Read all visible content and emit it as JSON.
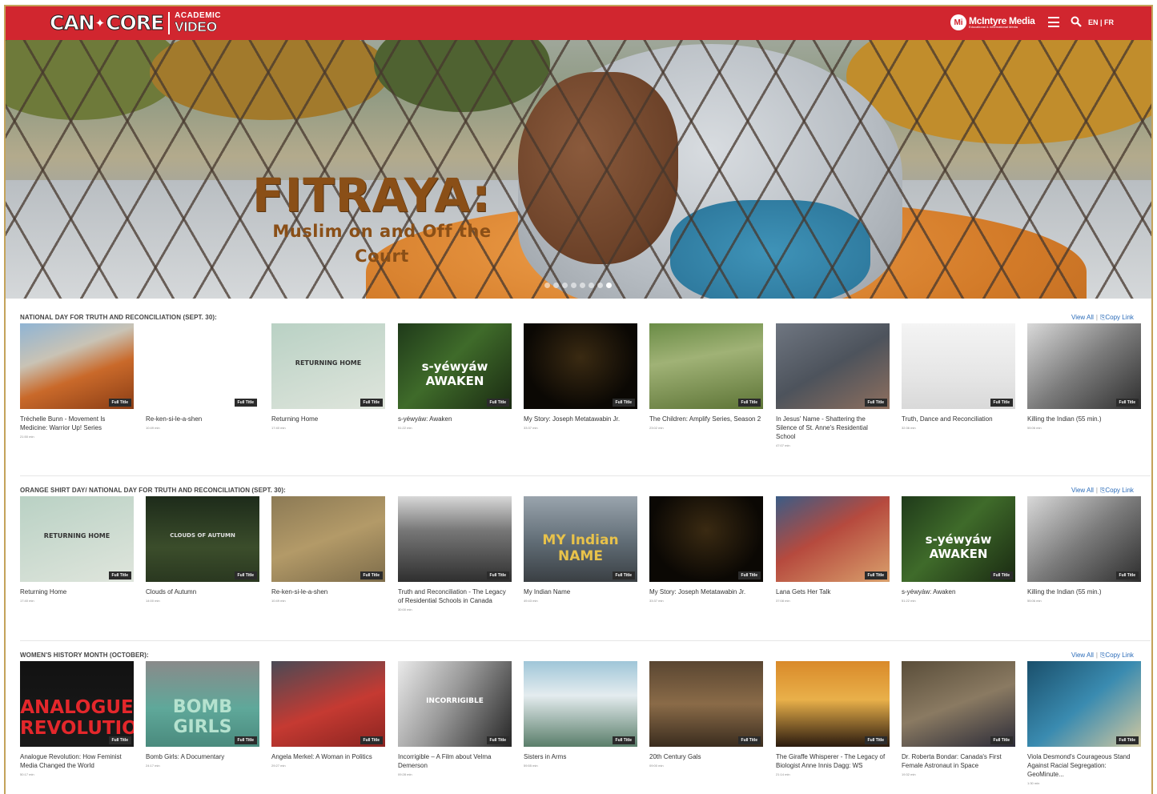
{
  "header": {
    "logo": {
      "can": "CAN",
      "core": "CORE",
      "academic": "ACADEMIC",
      "video": "VIDEO"
    },
    "brand": {
      "name": "McIntyre Media",
      "tag": "Educational & Informational Media"
    },
    "language": {
      "en": "EN",
      "sep": " | ",
      "fr": "FR"
    },
    "colors": {
      "accent": "#d1262f"
    }
  },
  "hero": {
    "title": "FITRAYA:",
    "subtitle": "Muslim on and Off the Court",
    "slides_total": 8,
    "active_slide": 8
  },
  "rows": [
    {
      "title": "NATIONAL DAY FOR TRUTH AND RECONCILIATION (SEPT. 30):",
      "view_all": "View All",
      "copy_link": "Copy Link",
      "items": [
        {
          "title": "Tréchelle Bunn - Movement Is Medicine: Warrior Up! Series",
          "time": "21:50 min",
          "badge": "Full Title",
          "thumb_text": ""
        },
        {
          "title": "Re-ken-si-le-a-shen",
          "time": "10:49 min",
          "badge": "Full Title",
          "thumb_text": ""
        },
        {
          "title": "Returning Home",
          "time": "17:40 min",
          "badge": "Full Title",
          "thumb_text": "RETURNING HOME"
        },
        {
          "title": "s-yéwyáw: Awaken",
          "time": "51:22 min",
          "badge": "Full Title",
          "thumb_text": "s-yéwyáw AWAKEN"
        },
        {
          "title": "My Story: Joseph Metatawabin Jr.",
          "time": "33:37 min",
          "badge": "Full Title",
          "thumb_text": ""
        },
        {
          "title": "The Children: Amplify Series, Season 2",
          "time": "23:02 min",
          "badge": "Full Title",
          "thumb_text": ""
        },
        {
          "title": "In Jesus' Name - Shattering the Silence of St. Anne's Residential School",
          "time": "47:07 min",
          "badge": "Full Title",
          "thumb_text": ""
        },
        {
          "title": "Truth, Dance and Reconciliation",
          "time": "32:36 min",
          "badge": "Full Title",
          "thumb_text": ""
        },
        {
          "title": "Killing the Indian (55 min.)",
          "time": "55:06 min",
          "badge": "Full Title",
          "thumb_text": ""
        }
      ]
    },
    {
      "title": "ORANGE SHIRT DAY/ NATIONAL DAY FOR TRUTH AND RECONCILIATION (SEPT. 30):",
      "view_all": "View All",
      "copy_link": "Copy Link",
      "items": [
        {
          "title": "Returning Home",
          "time": "17:40 min",
          "badge": "Full Title",
          "thumb_text": "RETURNING HOME"
        },
        {
          "title": "Clouds of Autumn",
          "time": "14:00 min",
          "badge": "Full Title",
          "thumb_text": "CLOUDS OF AUTUMN"
        },
        {
          "title": "Re-ken-si-le-a-shen",
          "time": "10:49 min",
          "badge": "Full Title",
          "thumb_text": ""
        },
        {
          "title": "Truth and Reconciliation - The Legacy of Residential Schools in Canada",
          "time": "30:00 min",
          "badge": "Full Title",
          "thumb_text": ""
        },
        {
          "title": "My Indian Name",
          "time": "49:43 min",
          "badge": "Full Title",
          "thumb_text": "MY Indian NAME"
        },
        {
          "title": "My Story: Joseph Metatawabin Jr.",
          "time": "33:37 min",
          "badge": "Full Title",
          "thumb_text": ""
        },
        {
          "title": "Lana Gets Her Talk",
          "time": "37:08 min",
          "badge": "Full Title",
          "thumb_text": ""
        },
        {
          "title": "s-yéwyáw: Awaken",
          "time": "51:22 min",
          "badge": "Full Title",
          "thumb_text": "s-yéwyáw AWAKEN"
        },
        {
          "title": "Killing the Indian (55 min.)",
          "time": "55:06 min",
          "badge": "Full Title",
          "thumb_text": ""
        }
      ]
    },
    {
      "title": "WOMEN'S HISTORY MONTH (OCTOBER):",
      "view_all": "View All",
      "copy_link": "Copy Link",
      "items": [
        {
          "title": "Analogue Revolution: How Feminist Media Changed the World",
          "time": "50:17 min",
          "badge": "Full Title",
          "thumb_text": "ANALOGUE REVOLUTION"
        },
        {
          "title": "Bomb Girls: A Documentary",
          "time": "24:17 min",
          "badge": "Full Title",
          "thumb_text": "BOMB GIRLS"
        },
        {
          "title": "Angela Merkel: A Woman in Politics",
          "time": "29:27 min",
          "badge": "Full Title",
          "thumb_text": ""
        },
        {
          "title": "Incorrigible – A Film about Velma Demerson",
          "time": "09:28 min",
          "badge": "Full Title",
          "thumb_text": "INCORRIGIBLE"
        },
        {
          "title": "Sisters in Arms",
          "time": "59:55 min",
          "badge": "Full Title",
          "thumb_text": ""
        },
        {
          "title": "20th Century Gals",
          "time": "09:00 min",
          "badge": "Full Title",
          "thumb_text": ""
        },
        {
          "title": "The Giraffe Whisperer - The Legacy of Biologist Anne Innis Dagg: WS",
          "time": "21:14 min",
          "badge": "Full Title",
          "thumb_text": ""
        },
        {
          "title": "Dr. Roberta Bondar: Canada's First Female Astronaut in Space",
          "time": "19:32 min",
          "badge": "Full Title",
          "thumb_text": ""
        },
        {
          "title": "Viola Desmond's Courageous Stand Against Racial Segregation: GeoMinute...",
          "time": "1:30 min",
          "badge": "Full Title",
          "thumb_text": ""
        }
      ]
    }
  ]
}
